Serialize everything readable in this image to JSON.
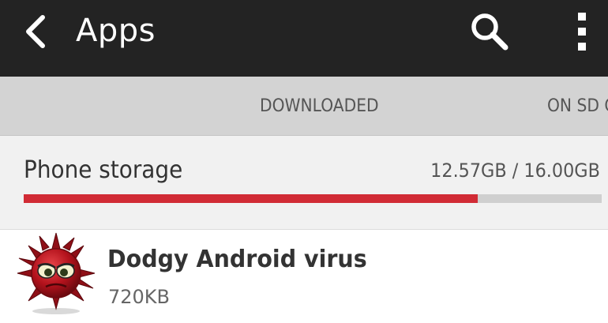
{
  "header": {
    "title": "Apps",
    "back_icon": "back-arrow-icon",
    "search_icon": "search-icon",
    "menu_icon": "overflow-menu-icon",
    "background": "#232323"
  },
  "tabs": [
    {
      "label": "DOWNLOADED"
    },
    {
      "label": "ON SD C"
    }
  ],
  "storage": {
    "label": "Phone storage",
    "value": "12.57GB / 16.00GB",
    "used_fraction": 0.786,
    "bar_color": "#d12b35",
    "track_color": "#cfcfcf"
  },
  "apps": [
    {
      "name": "Dodgy Android virus",
      "size": "720KB",
      "icon": "virus-icon"
    }
  ]
}
